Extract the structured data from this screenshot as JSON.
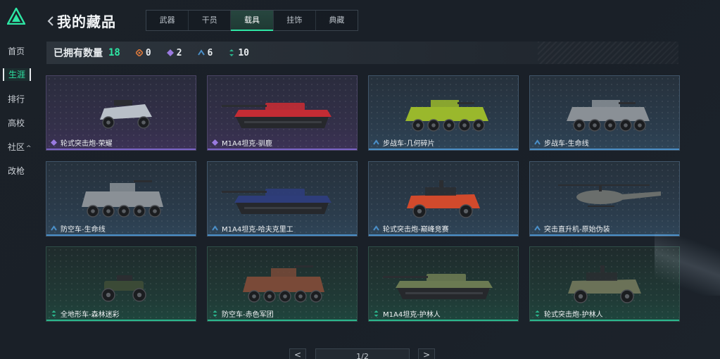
{
  "app": {
    "title": "我的藏品"
  },
  "sidebar": {
    "items": [
      {
        "label": "首页",
        "active": false
      },
      {
        "label": "生涯",
        "active": true
      },
      {
        "label": "排行",
        "active": false
      },
      {
        "label": "高校",
        "active": false
      },
      {
        "label": "社区",
        "active": false,
        "caret": "^"
      },
      {
        "label": "改枪",
        "active": false
      }
    ]
  },
  "tabs": [
    {
      "label": "武器",
      "active": false
    },
    {
      "label": "干员",
      "active": false
    },
    {
      "label": "载具",
      "active": true
    },
    {
      "label": "挂饰",
      "active": false
    },
    {
      "label": "典藏",
      "active": false
    }
  ],
  "stats": {
    "label": "已拥有数量",
    "total": "18",
    "rarities": [
      {
        "icon": "orange-diamond-icon",
        "color": "#d9773a",
        "count": "0"
      },
      {
        "icon": "purple-diamond-icon",
        "color": "#9a7ae0",
        "count": "2"
      },
      {
        "icon": "blue-chevron-icon",
        "color": "#4a8fc8",
        "count": "6"
      },
      {
        "icon": "green-arrows-icon",
        "color": "#2bb78e",
        "count": "10"
      }
    ]
  },
  "cards": [
    {
      "name": "轮式突击炮-荣耀",
      "rarity": "epic",
      "vehicle": "wheeled-assault-gun",
      "livery": "#b9c0c8"
    },
    {
      "name": "M1A4坦克-驯鹿",
      "rarity": "epic",
      "vehicle": "tank",
      "livery": "#c42c34"
    },
    {
      "name": "步战车-几何碎片",
      "rarity": "rare",
      "vehicle": "ifv",
      "livery": "#9ab82c"
    },
    {
      "name": "步战车-生命线",
      "rarity": "rare",
      "vehicle": "ifv-big",
      "livery": "#8a9096"
    },
    {
      "name": "防空车-生命线",
      "rarity": "rare",
      "vehicle": "aa-vehicle",
      "livery": "#8a9096"
    },
    {
      "name": "M1A4坦克-哈夫克里工",
      "rarity": "rare",
      "vehicle": "tank",
      "livery": "#2e3d7a"
    },
    {
      "name": "轮式突击炮-巅峰竞赛",
      "rarity": "rare",
      "vehicle": "buggy",
      "livery": "#d24a2c"
    },
    {
      "name": "突击直升机-原始伪装",
      "rarity": "rare",
      "vehicle": "helicopter",
      "livery": "#6a6e6c"
    },
    {
      "name": "全地形车-森林迷彩",
      "rarity": "common",
      "vehicle": "atv",
      "livery": "#3b4a36"
    },
    {
      "name": "防空车-赤色军团",
      "rarity": "common",
      "vehicle": "aa-vehicle",
      "livery": "#7a4a38"
    },
    {
      "name": "M1A4坦克-护林人",
      "rarity": "common",
      "vehicle": "tank",
      "livery": "#6b7a52"
    },
    {
      "name": "轮式突击炮-护林人",
      "rarity": "common",
      "vehicle": "buggy",
      "livery": "#6b7258"
    }
  ],
  "pagination": {
    "page": "1/2",
    "prev_label": "<",
    "next_label": ">"
  }
}
